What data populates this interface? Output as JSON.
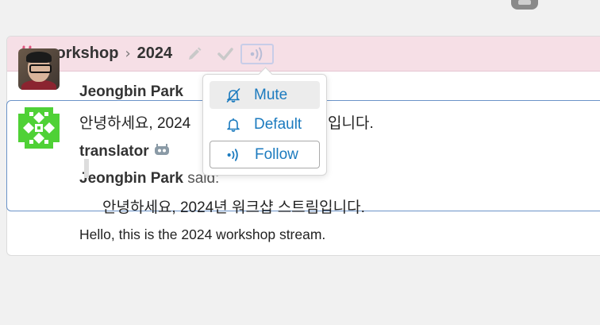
{
  "header": {
    "stream": "workshop",
    "topic": "2024",
    "colors": {
      "hash": "#e0567f",
      "header_bg": "#f6dfe6"
    }
  },
  "messages": [
    {
      "sender": "Jeongbin Park",
      "content": "안녕하세요, 2024",
      "content_tail": "입니다."
    },
    {
      "sender": "translator",
      "quoted_sender": "Jeongbin Park",
      "said": "said:",
      "quote": "안녕하세요, 2024년 워크샵 스트림입니다.",
      "content": "Hello, this is the 2024 workshop stream."
    }
  ],
  "popover": {
    "items": [
      {
        "label": "Mute",
        "icon": "bell-slash-icon"
      },
      {
        "label": "Default",
        "icon": "bell-icon"
      },
      {
        "label": "Follow",
        "icon": "follow-icon"
      }
    ],
    "selected": "Follow"
  }
}
